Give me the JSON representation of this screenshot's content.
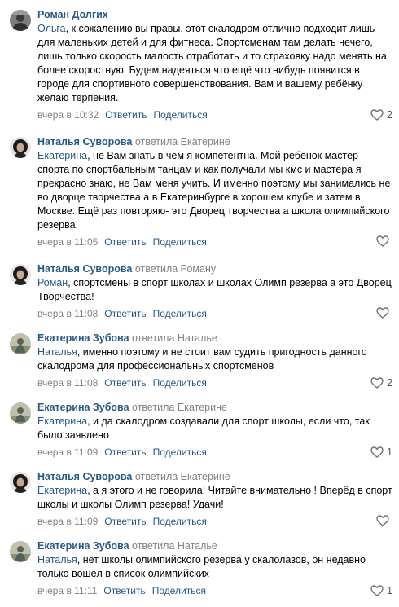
{
  "ui": {
    "reply_label": "Ответить",
    "share_label": "Поделиться"
  },
  "comments": [
    {
      "author": "Роман Долгих",
      "replied_to": "",
      "mention": "Ольга",
      "text": ", к сожалению вы правы, этот скалодром отлично подходит лишь для маленьких детей и для фитнеса. Спортсменам там делать нечего, лишь только скорость малость отработать и то страховку надо менять на более скоростную. Будем надеяться что ещё что нибудь появится в городе для спортивного совершенствования. Вам и вашему ребёнку желаю терпения.",
      "date": "вчера в 10:32",
      "likes": "2",
      "avatar": "roman"
    },
    {
      "author": "Наталья Суворова",
      "replied_to": "ответила Екатерине",
      "mention": "Екатерина",
      "text": ", не Вам знать в чем я компетентна. Мой ребёнок мастер спорта по спортбальным танцам и как получали мы кмс и мастера я прекрасно знаю, не Вам меня учить. И именно поэтому мы занимались не во дворце творчества а в Екатеринбурге в хорошем клубе и затем в Москве. Ещё раз повторяю- это Дворец творчества а школа олимпийского резерва.",
      "date": "вчера в 11:05",
      "likes": "",
      "avatar": "natalia"
    },
    {
      "author": "Наталья Суворова",
      "replied_to": "ответила Роману",
      "mention": "Роман",
      "text": ", спортсмены в спорт школах и школах Олимп резерва а это Дворец Творчества!",
      "date": "вчера в 11:08",
      "likes": "",
      "avatar": "natalia"
    },
    {
      "author": "Екатерина Зубова",
      "replied_to": "ответила Наталье",
      "mention": "Наталья",
      "text": ", именно поэтому и не стоит вам судить пригодность данного скалодрома для профессиональных спортсменов",
      "date": "вчера в 11:08",
      "likes": "2",
      "avatar": "ekaterina"
    },
    {
      "author": "Екатерина Зубова",
      "replied_to": "ответила Екатерине",
      "mention": "Екатерина",
      "text": ", и да скалодром создавали для спорт школы, если что, так было заявлено",
      "date": "вчера в 11:09",
      "likes": "1",
      "avatar": "ekaterina"
    },
    {
      "author": "Наталья Суворова",
      "replied_to": "ответила Екатерине",
      "mention": "Екатерина",
      "text": ", а я этого и не говорила! Читайте внимательно ! Вперёд в спорт школы и школы Олимп резерва! Удачи!",
      "date": "вчера в 11:09",
      "likes": "",
      "avatar": "natalia"
    },
    {
      "author": "Екатерина Зубова",
      "replied_to": "ответила Наталье",
      "mention": "Наталья",
      "text": ", нет школы олимпийского резерва у скалолазов, он недавно только вошёл в список олимпийских",
      "date": "вчера в 11:11",
      "likes": "1",
      "avatar": "ekaterina"
    }
  ]
}
